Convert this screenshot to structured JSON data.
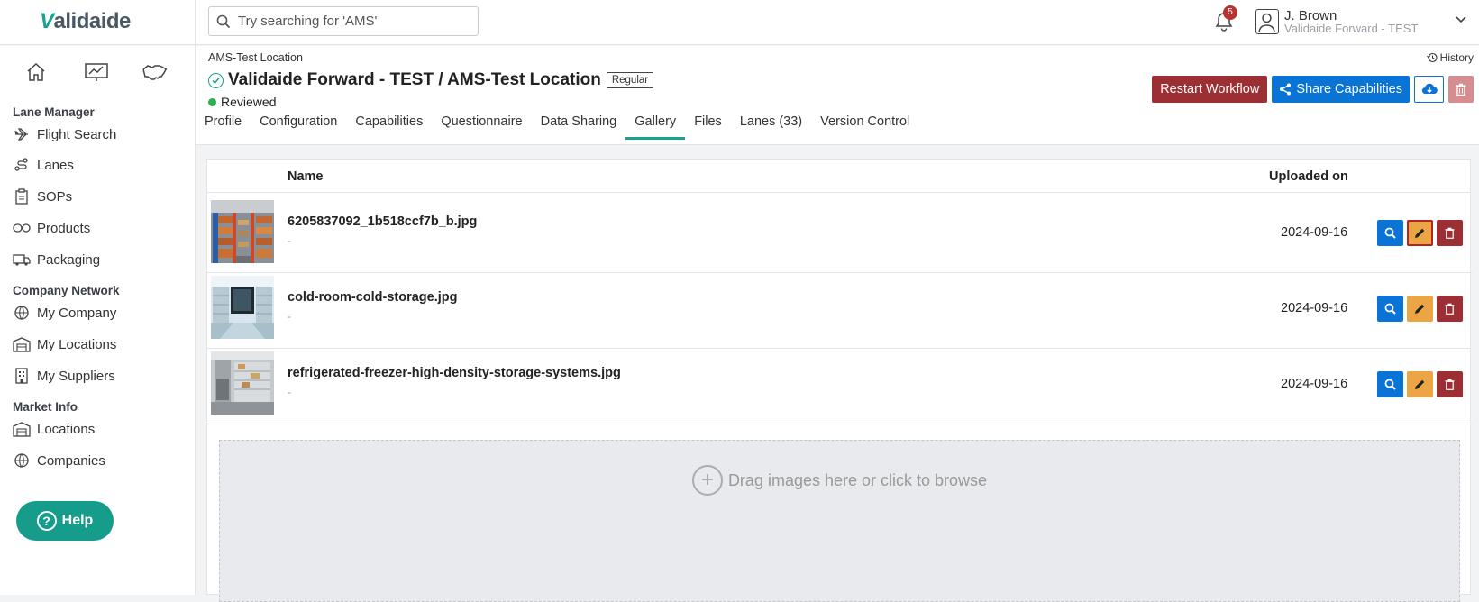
{
  "app": {
    "logo_text": "alidaide",
    "logo_mark": "V"
  },
  "search": {
    "placeholder": "Try searching for 'AMS'"
  },
  "notifications": {
    "count": "5"
  },
  "user": {
    "name": "J. Brown",
    "org": "Validaide Forward - TEST"
  },
  "sidebar": {
    "sections": [
      {
        "title": "Lane Manager",
        "items": [
          "Flight Search",
          "Lanes",
          "SOPs",
          "Products",
          "Packaging"
        ]
      },
      {
        "title": "Company Network",
        "items": [
          "My Company",
          "My Locations",
          "My Suppliers"
        ]
      },
      {
        "title": "Market Info",
        "items": [
          "Locations",
          "Companies"
        ]
      }
    ],
    "help_label": "Help"
  },
  "header": {
    "breadcrumb": "AMS-Test Location",
    "history_label": "History",
    "title": "Validaide Forward - TEST / AMS-Test Location",
    "tag": "Regular",
    "status": "Reviewed",
    "restart_label": "Restart Workflow",
    "share_label": "Share Capabilities"
  },
  "tabs": [
    "Profile",
    "Configuration",
    "Capabilities",
    "Questionnaire",
    "Data Sharing",
    "Gallery",
    "Files",
    "Lanes (33)",
    "Version Control"
  ],
  "active_tab": "Gallery",
  "gallery": {
    "columns": {
      "name": "Name",
      "uploaded": "Uploaded on"
    },
    "rows": [
      {
        "name": "6205837092_1b518ccf7b_b.jpg",
        "desc": "-",
        "date": "2024-09-16"
      },
      {
        "name": "cold-room-cold-storage.jpg",
        "desc": "-",
        "date": "2024-09-16"
      },
      {
        "name": "refrigerated-freezer-high-density-storage-systems.jpg",
        "desc": "-",
        "date": "2024-09-16"
      }
    ],
    "dropzone_label": "Drag images here or click to browse"
  },
  "colors": {
    "accent": "#1aa18f",
    "primary": "#0a74d6",
    "danger": "#9b2f34",
    "warning": "#eca545"
  }
}
